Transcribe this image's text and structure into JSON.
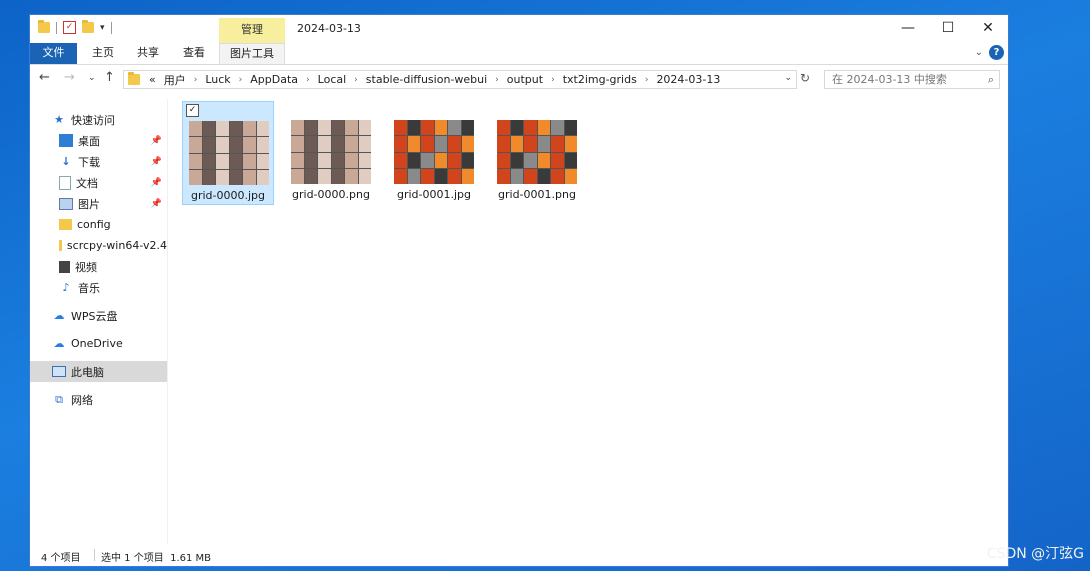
{
  "titlebar": {
    "context_tab": "管理",
    "title": "2024-03-13",
    "minimize": "—",
    "maximize": "☐",
    "close": "✕"
  },
  "ribbon": {
    "tabs": [
      "文件",
      "主页",
      "共享",
      "查看",
      "图片工具"
    ],
    "help": "?"
  },
  "address": {
    "overflow": "«",
    "crumbs": [
      "用户",
      "Luck",
      "AppData",
      "Local",
      "stable-diffusion-webui",
      "output",
      "txt2img-grids",
      "2024-03-13"
    ],
    "search_placeholder": "在 2024-03-13 中搜索"
  },
  "sidebar": {
    "items": [
      {
        "label": "快速访问",
        "icon": "star-icon"
      },
      {
        "label": "桌面",
        "icon": "desktop-icon",
        "pinned": true
      },
      {
        "label": "下载",
        "icon": "download-icon",
        "pinned": true
      },
      {
        "label": "文档",
        "icon": "document-icon",
        "pinned": true
      },
      {
        "label": "图片",
        "icon": "pictures-icon",
        "pinned": true
      },
      {
        "label": "config",
        "icon": "folder-icon"
      },
      {
        "label": "scrcpy-win64-v2.4",
        "icon": "folder-icon"
      },
      {
        "label": "视频",
        "icon": "video-icon"
      },
      {
        "label": "音乐",
        "icon": "music-icon"
      },
      {
        "label": "WPS云盘",
        "icon": "cloud-icon"
      },
      {
        "label": "OneDrive",
        "icon": "onedrive-icon"
      },
      {
        "label": "此电脑",
        "icon": "this-pc-icon",
        "selected": true
      },
      {
        "label": "网络",
        "icon": "network-icon"
      }
    ]
  },
  "files": [
    {
      "name": "grid-0000.jpg",
      "selected": true
    },
    {
      "name": "grid-0000.png"
    },
    {
      "name": "grid-0001.jpg"
    },
    {
      "name": "grid-0001.png"
    }
  ],
  "status": {
    "count": "4 个项目",
    "selection": "选中 1 个项目  1.61 MB"
  },
  "watermark": "CSDN @汀弦G",
  "colors": {
    "accent": "#1a63b5",
    "selection": "#cce8ff",
    "context_tab": "#f7ef9e"
  }
}
